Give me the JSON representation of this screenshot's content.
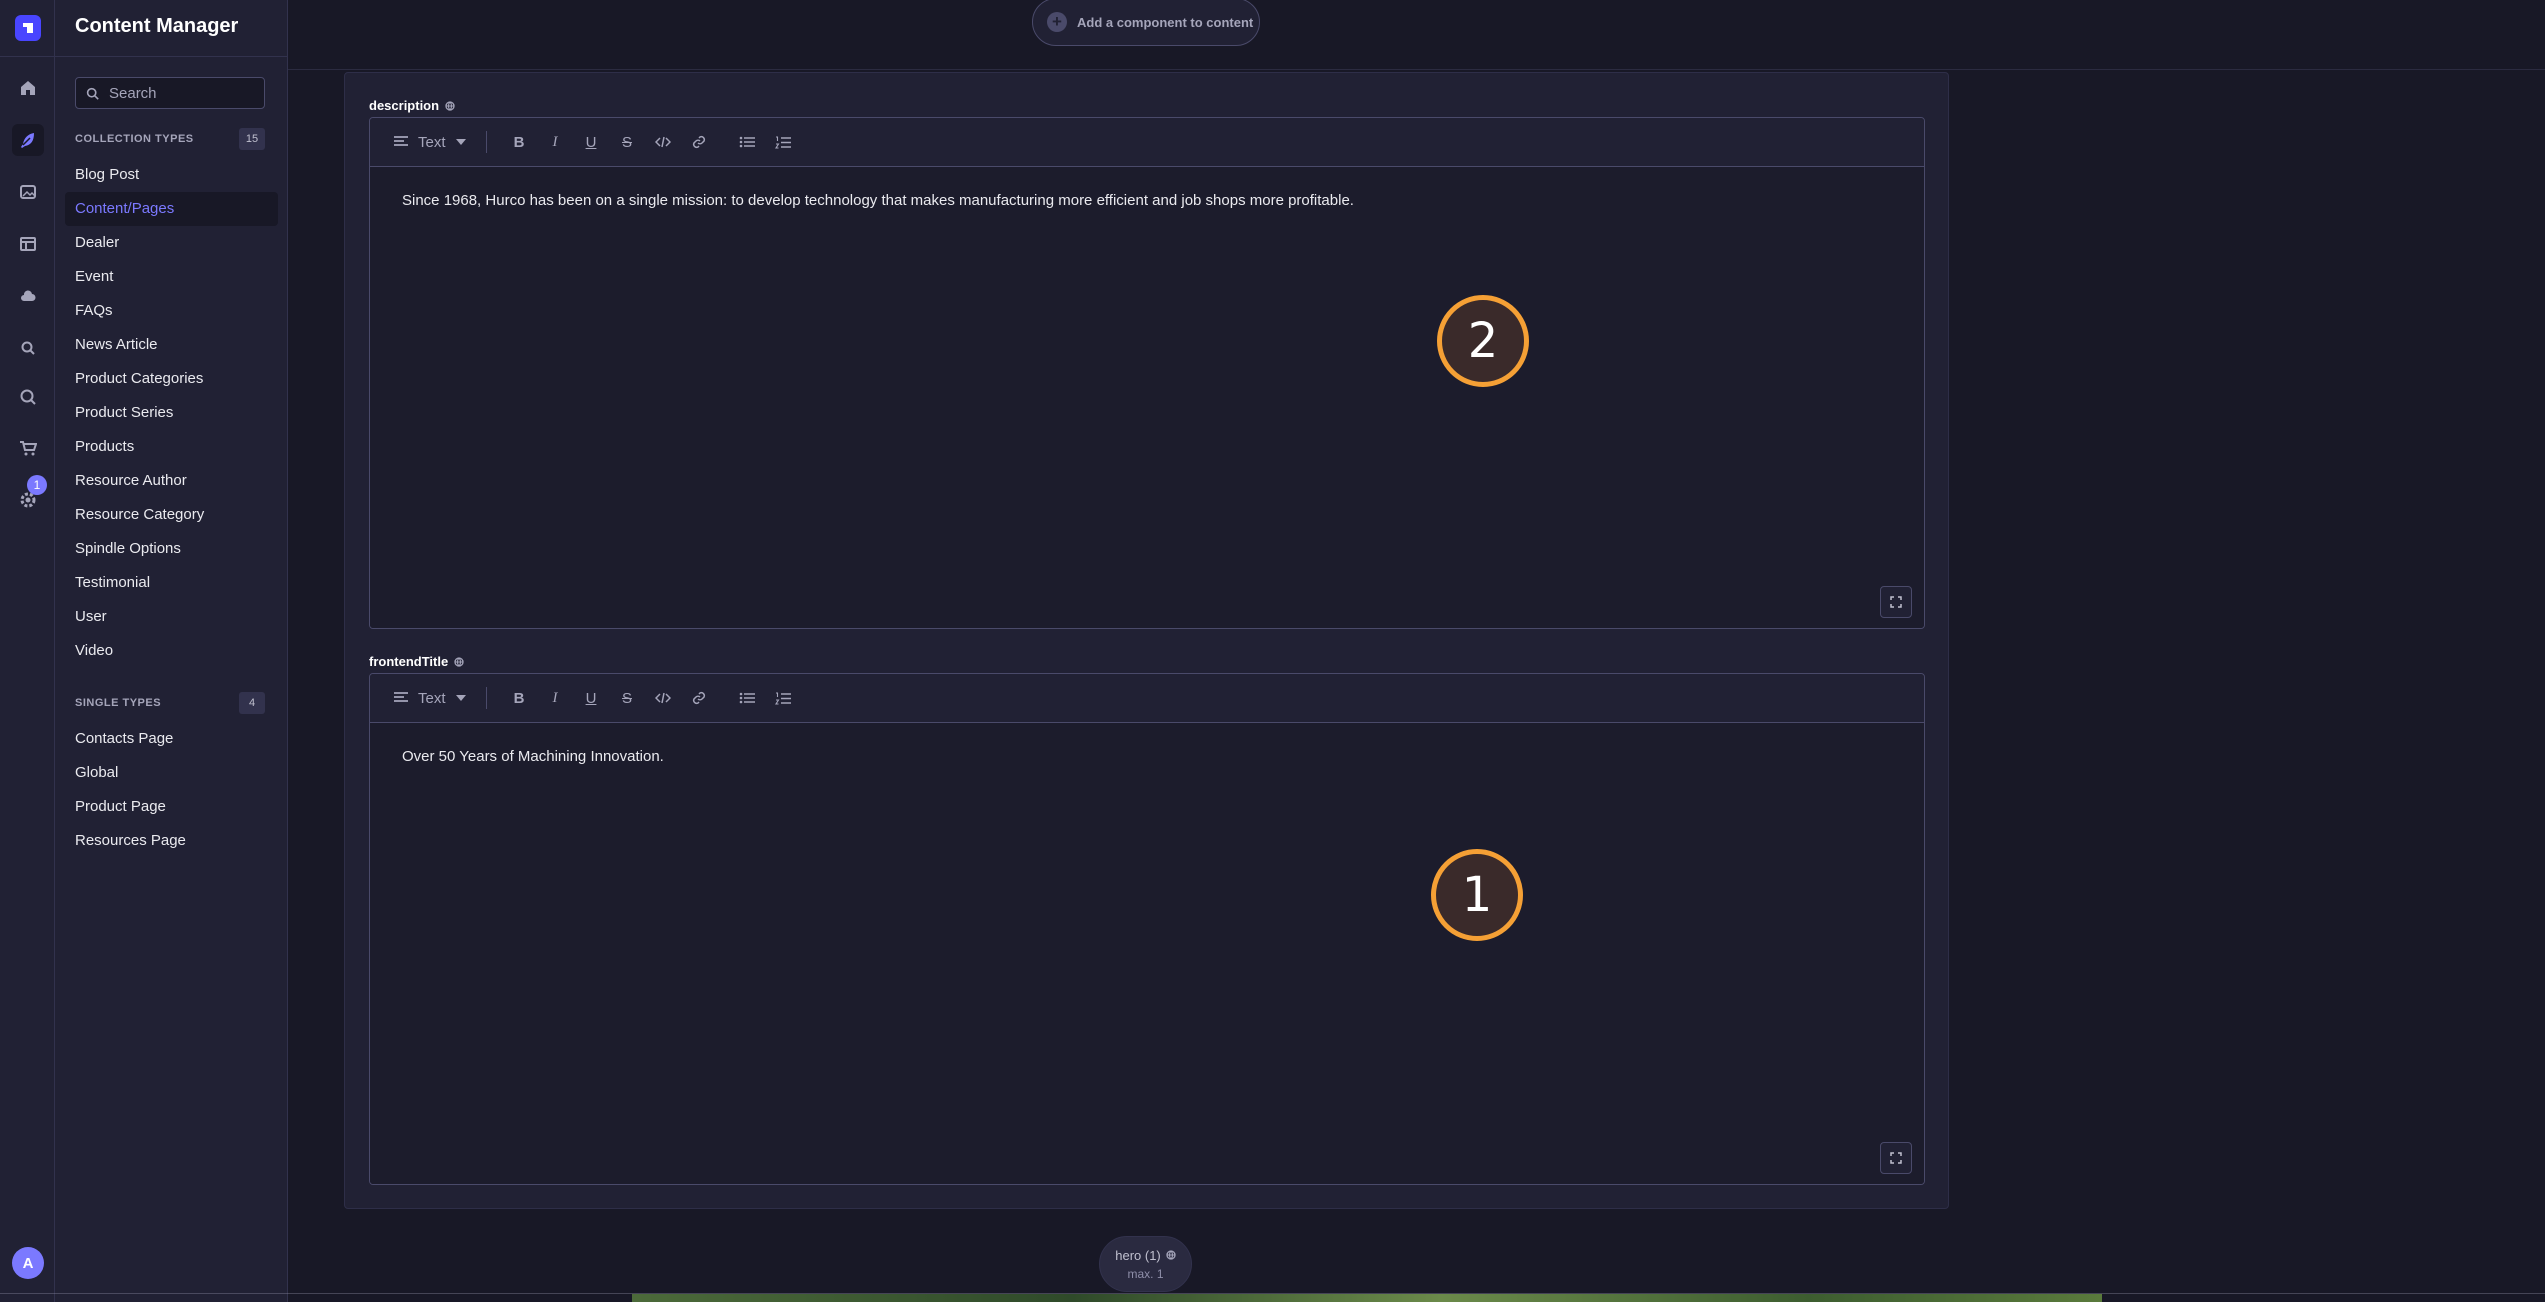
{
  "app": {
    "title": "Content Manager",
    "notification_count": "1",
    "avatar_initial": "A"
  },
  "colors": {
    "accent": "#7b79ff",
    "brand": "#4945ff",
    "marker_ring": "#f5a035"
  },
  "rail": {
    "icons": [
      "home-icon",
      "feather-icon",
      "media-icon",
      "layout-icon",
      "cloud-icon",
      "search-small-icon",
      "search-icon",
      "cart-icon",
      "settings-icon"
    ],
    "active": "feather-icon"
  },
  "search": {
    "placeholder": "Search"
  },
  "collection_types": {
    "label": "COLLECTION TYPES",
    "count": "15",
    "items": [
      {
        "label": "Blog Post"
      },
      {
        "label": "Content/Pages",
        "active": true
      },
      {
        "label": "Dealer"
      },
      {
        "label": "Event"
      },
      {
        "label": "FAQs"
      },
      {
        "label": "News Article"
      },
      {
        "label": "Product Categories"
      },
      {
        "label": "Product Series"
      },
      {
        "label": "Products"
      },
      {
        "label": "Resource Author"
      },
      {
        "label": "Resource Category"
      },
      {
        "label": "Spindle Options"
      },
      {
        "label": "Testimonial"
      },
      {
        "label": "User"
      },
      {
        "label": "Video"
      }
    ]
  },
  "single_types": {
    "label": "SINGLE TYPES",
    "count": "4",
    "items": [
      {
        "label": "Contacts Page"
      },
      {
        "label": "Global"
      },
      {
        "label": "Product Page"
      },
      {
        "label": "Resources Page"
      }
    ]
  },
  "main": {
    "add_component_label": "Add a component to content",
    "fields": [
      {
        "label": "description",
        "style_select": "Text",
        "content": "Since 1968, Hurco has been on a single mission: to develop technology that makes manufacturing more efficient and job shops more profitable.",
        "marker": "2"
      },
      {
        "label": "frontendTitle",
        "style_select": "Text",
        "content": "Over 50 Years of Machining Innovation.",
        "marker": "1"
      }
    ],
    "toolbar_buttons": [
      "bold-icon",
      "italic-icon",
      "underline-icon",
      "strikethrough-icon",
      "code-icon",
      "link-icon",
      "bullet-list-icon",
      "numbered-list-icon"
    ],
    "hero": {
      "title": "hero (1)",
      "subtitle": "max. 1"
    }
  }
}
